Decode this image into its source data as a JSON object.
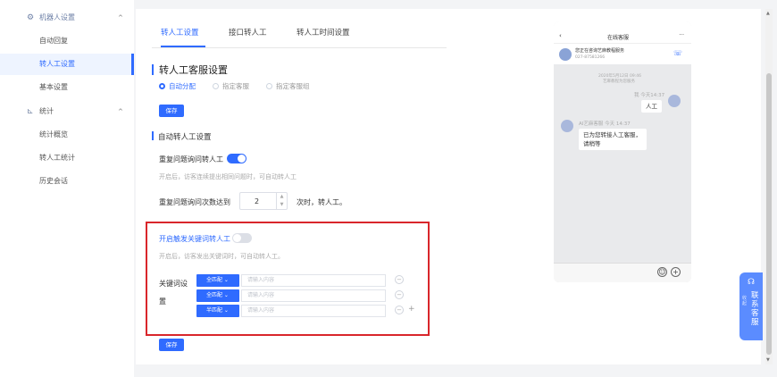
{
  "sidebar": {
    "group_robot": "机器人设置",
    "items": [
      {
        "label": "自动回复"
      },
      {
        "label": "转人工设置"
      },
      {
        "label": "基本设置"
      }
    ],
    "group_stats": "统计",
    "stats_items": [
      {
        "label": "统计概览"
      },
      {
        "label": "转人工统计"
      },
      {
        "label": "历史会话"
      }
    ]
  },
  "tabs": [
    "转人工设置",
    "接口转人工",
    "转人工时间设置"
  ],
  "manual_section": {
    "title": "转人工客服设置",
    "radios": [
      "自动分配",
      "指定客服",
      "指定客服组"
    ],
    "save": "保存"
  },
  "auto_section": {
    "title": "自动转人工设置",
    "repeat_label": "重复问题询问转人工",
    "repeat_hint": "开启后，访客连续提出相同问题时，可自动转人工",
    "count_label_pre": "重复问题询问次数达到",
    "count_value": "2",
    "count_label_post": "次时，转人工。"
  },
  "keyword_section": {
    "toggle_label": "开启触发关键词转人工",
    "hint": "开启后，访客发出关键词时，可自动转人工。",
    "keyword_label_1": "关键词设",
    "keyword_label_2": "置",
    "rows": [
      {
        "match": "全匹配",
        "placeholder": "请输入内容"
      },
      {
        "match": "全匹配",
        "placeholder": "请输入内容"
      },
      {
        "match": "半匹配",
        "placeholder": "请输入内容"
      }
    ],
    "save": "保存"
  },
  "phone": {
    "title": "在线客服",
    "company": "您正在咨询艺麻教程服务",
    "phone_num": "027-87581266",
    "timestamp": "2020年5月12日 09:46",
    "timestamp_note": "艺麻教程为您服务",
    "user_time": "我 今天14:37",
    "user_msg": "人工",
    "agent_time": "AI艺麻客服 今天 14:37",
    "agent_msg": "已为您转接人工客服，请稍等"
  },
  "contact": {
    "text": "联系客服",
    "side": "收起"
  }
}
